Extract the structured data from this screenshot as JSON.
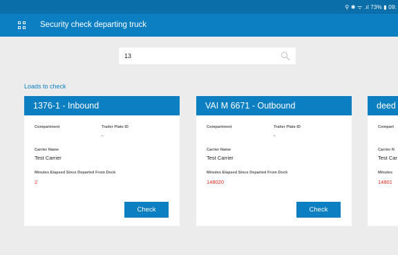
{
  "status_bar": {
    "text": "⚲ ✱ ᯤ .ıl 73% ▮ 09:"
  },
  "app_bar": {
    "title": "Security check departing truck"
  },
  "search": {
    "value": "13",
    "placeholder": ""
  },
  "section": {
    "label": "Loads to check"
  },
  "labels": {
    "compartment": "Compartment",
    "trailer_plate": "Trailer Plate ID",
    "carrier_name": "Carrier Name",
    "minutes_elapsed": "Minutes Elapsed Since Departed From Dock",
    "check": "Check"
  },
  "cards": [
    {
      "title": "1376-1 - Inbound",
      "compartment": "",
      "trailer_plate": "-",
      "carrier": "Test Carrier",
      "minutes": "2"
    },
    {
      "title": "VAI M 6671 - Outbound",
      "compartment": "",
      "trailer_plate": "-",
      "carrier": "Test Carrier",
      "minutes": "148020"
    },
    {
      "title": "deed",
      "compartment_label": "Compart",
      "carrier_label": "Carrier N",
      "carrier": "Test Car",
      "minutes_label": "Minutes",
      "minutes": "14801"
    }
  ],
  "colors": {
    "primary": "#0b7fc1",
    "status_bar": "#0a6fa8",
    "background": "#ececec",
    "elapsed_value": "#e0291a"
  }
}
